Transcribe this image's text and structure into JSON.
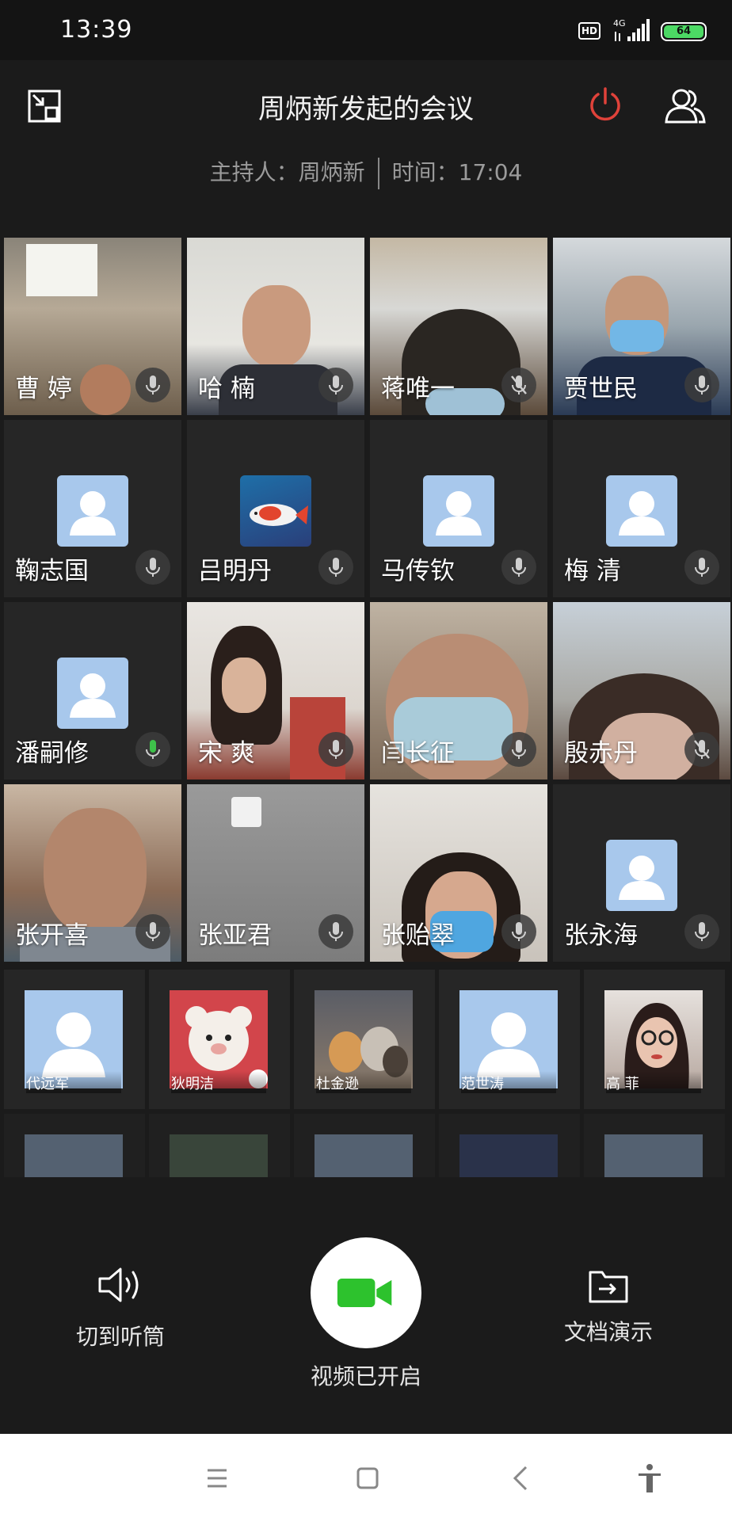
{
  "status_bar": {
    "time": "13:39",
    "hd": "HD",
    "network": "4G",
    "battery": "64"
  },
  "header": {
    "title": "周炳新发起的会议",
    "host_label": "主持人：周炳新",
    "time_label": "时间：17:04",
    "icons": [
      "shrink-window-icon",
      "power-icon",
      "members-icon"
    ],
    "power_color": "#e0423a"
  },
  "participants": [
    {
      "name": "曹 婷",
      "video": true,
      "mic": "normal"
    },
    {
      "name": "哈 楠",
      "video": true,
      "mic": "normal"
    },
    {
      "name": "蒋唯一",
      "video": true,
      "mic": "muted"
    },
    {
      "name": "贾世民",
      "video": true,
      "mic": "normal"
    },
    {
      "name": "鞠志国",
      "video": false,
      "mic": "normal"
    },
    {
      "name": "吕明丹",
      "video": false,
      "mic": "normal"
    },
    {
      "name": "马传钦",
      "video": false,
      "mic": "normal"
    },
    {
      "name": "梅 清",
      "video": false,
      "mic": "normal"
    },
    {
      "name": "潘嗣修",
      "video": false,
      "mic": "speaking"
    },
    {
      "name": "宋 爽",
      "video": true,
      "mic": "normal"
    },
    {
      "name": "闫长征",
      "video": true,
      "mic": "normal"
    },
    {
      "name": "殷赤丹",
      "video": true,
      "mic": "muted"
    },
    {
      "name": "张开喜",
      "video": true,
      "mic": "normal"
    },
    {
      "name": "张亚君",
      "video": true,
      "mic": "normal"
    },
    {
      "name": "张贻翠",
      "video": true,
      "mic": "normal"
    },
    {
      "name": "张永海",
      "video": false,
      "mic": "normal"
    }
  ],
  "small_participants": [
    {
      "name": "代远军"
    },
    {
      "name": "狄明洁"
    },
    {
      "name": "杜金逊"
    },
    {
      "name": "范世涛"
    },
    {
      "name": "高 菲"
    }
  ],
  "controls": {
    "speaker_label": "切到听筒",
    "video_label": "视频已开启",
    "doc_label": "文档演示",
    "video_color": "#2dc22d"
  },
  "colors": {
    "background": "#1b1b1b",
    "tile": "#262626",
    "avatar_placeholder": "#a8c8ec",
    "speaking_mic": "#3ec24a"
  }
}
